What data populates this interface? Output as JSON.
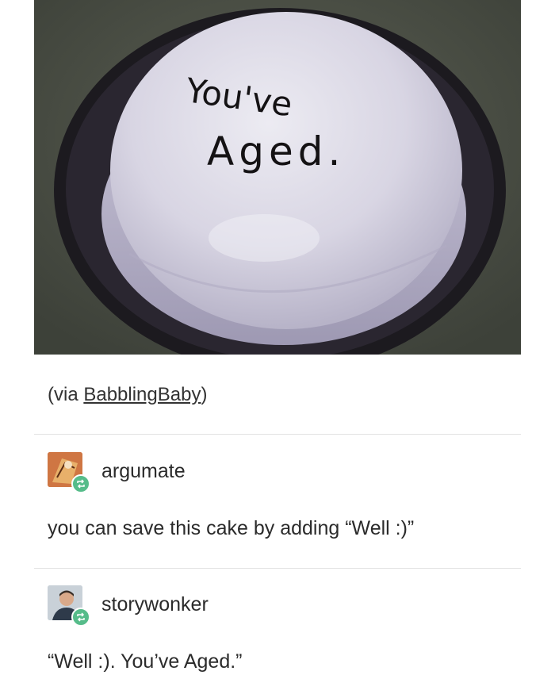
{
  "post": {
    "image_text": {
      "line1": "You've",
      "line2": "Aged."
    },
    "caption": {
      "prefix": "(via ",
      "source_link": "BabblingBaby",
      "suffix": ")"
    }
  },
  "reblogs": [
    {
      "username": "argumate",
      "text": "you can save this cake by adding “Well :)”",
      "avatar_icon": "avatar-argumate"
    },
    {
      "username": "storywonker",
      "text": "“Well :). You’ve Aged.”",
      "avatar_icon": "avatar-storywonker"
    }
  ],
  "colors": {
    "reblog_badge": "#56bc8a",
    "frosting": "#d9d6e4",
    "background": "#4e5248"
  }
}
